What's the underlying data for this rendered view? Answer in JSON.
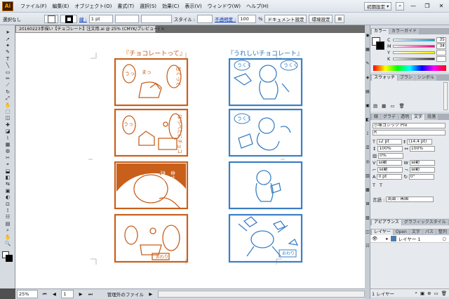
{
  "app": {
    "logo": "Ai",
    "workspace": "初期設定"
  },
  "menus": [
    "ファイル(F)",
    "編集(E)",
    "オブジェクト(O)",
    "書式(T)",
    "選択(S)",
    "効果(C)",
    "表示(V)",
    "ウィンドウ(W)",
    "ヘルプ(H)"
  ],
  "control": {
    "selection": "選択なし",
    "stroke_label": "線 :",
    "stroke_width": "1 pt",
    "style_label": "スタイル :",
    "opacity_label": "不透明度 :",
    "opacity_value": "100",
    "opacity_unit": "%",
    "doc_setup": "ドキュメント設定",
    "prefs": "環境設定"
  },
  "document": {
    "tab_title": "20160223手描い【チョコレート】注文用.ai @ 25% (CMYK/プレビュー)",
    "close": "×"
  },
  "status": {
    "zoom": "25%",
    "page": "1",
    "info": "管理外のファイル"
  },
  "color_panel": {
    "tabs": [
      "カラー",
      "カラーガイド"
    ],
    "channels": [
      {
        "label": "C",
        "value": "35",
        "color": "#00a0e9"
      },
      {
        "label": "M",
        "value": "34",
        "color": "#e4007f"
      },
      {
        "label": "Y",
        "value": "",
        "color": "#fff100"
      },
      {
        "label": "K",
        "value": "",
        "color": "#222222"
      }
    ]
  },
  "swatch_panel": {
    "tabs": [
      "スウォッチ",
      "ブラシ",
      "シンボル"
    ]
  },
  "char_panel": {
    "tabs": [
      "線",
      "グラデ",
      "透明",
      "文字",
      "段落"
    ],
    "font": "小塚ゴシック Pro",
    "style": "R",
    "size": "12 pt",
    "leading": "(14.4 pt)",
    "scale_v": "100%",
    "scale_h": "100%",
    "tracking": "0%",
    "kerning": "自動",
    "auto2": "自動",
    "auto3": "自動",
    "auto4": "自動",
    "baseline": "0 pt",
    "rotation": "0°",
    "language_label": "言語 :",
    "language": "英語 : 米国"
  },
  "appearance_panel": {
    "tabs": [
      "アピアランス",
      "グラフィックスタイル"
    ]
  },
  "layers_panel": {
    "tabs": [
      "レイヤー",
      "Open",
      "文字",
      "パス",
      "整列"
    ],
    "layer_name": "レイヤー 1",
    "footer": "1 レイヤー"
  },
  "artboard": {
    "left_caption": "『チョコレートって』",
    "right_caption": "『うれしいチョコレート』",
    "left_color": "#d2691e",
    "right_color": "#3a7fc4",
    "left_bubbles": [
      "甘くって",
      "うっ",
      "まっ",
      "ほっぺたにチョコ",
      "うっ",
      "幸せな",
      "恋の味",
      "おわり"
    ],
    "right_bubbles": [
      "うくく",
      "うくく",
      "うくく",
      "おわり"
    ]
  }
}
